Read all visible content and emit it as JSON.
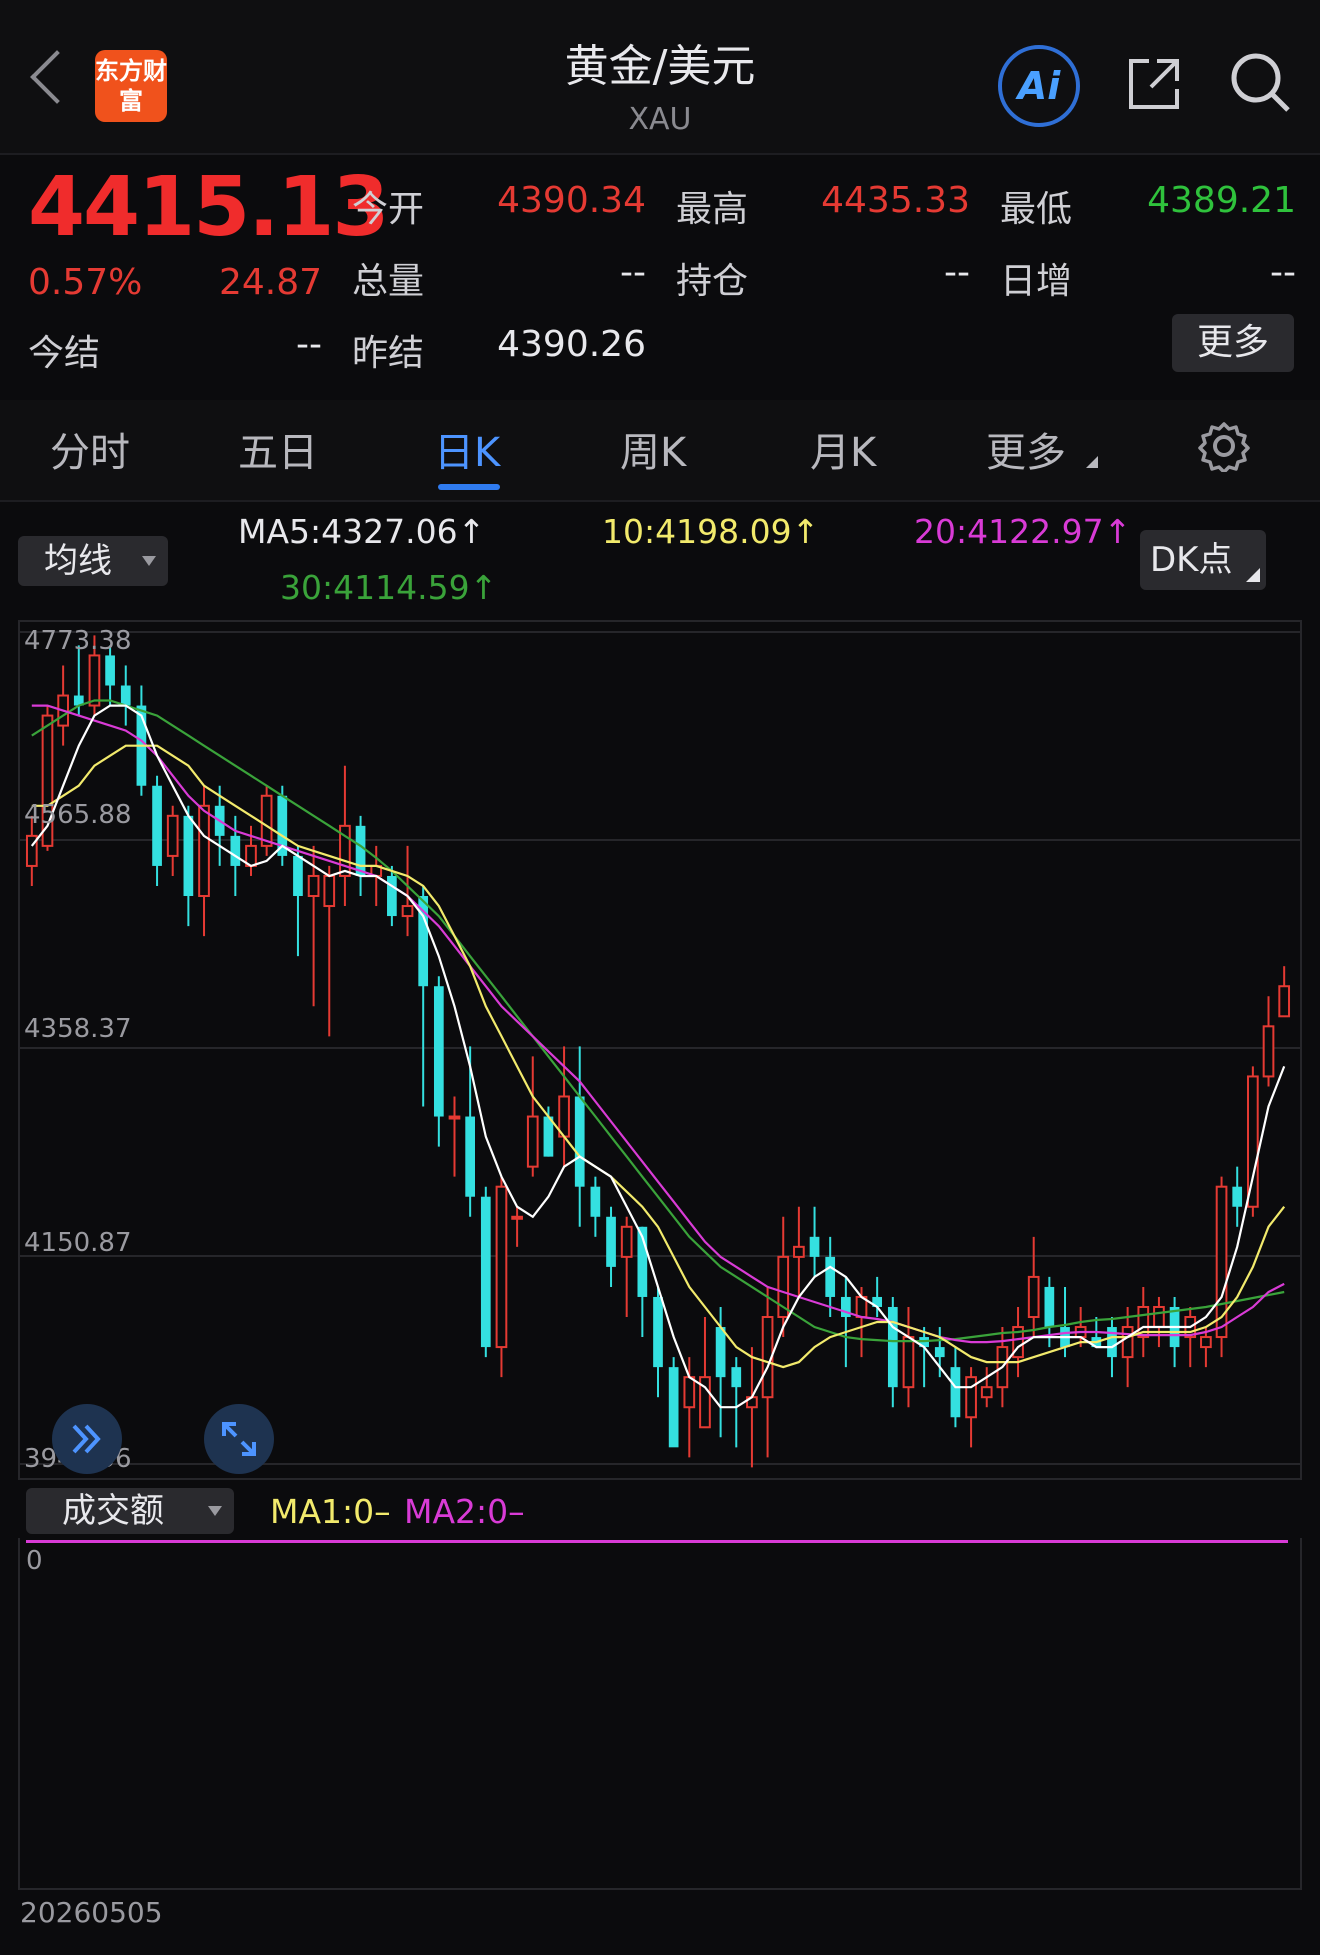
{
  "header": {
    "logo_text": "东方财富",
    "title": "黄金/美元",
    "subtitle": "XAU",
    "ai_label": "Ai"
  },
  "quote": {
    "price": "4415.13",
    "change_pct": "0.57%",
    "change": "24.87",
    "open_label": "今开",
    "open": "4390.34",
    "high_label": "最高",
    "high": "4435.33",
    "low_label": "最低",
    "low": "4389.21",
    "volume_label": "总量",
    "volume": "--",
    "oi_label": "持仓",
    "oi": "--",
    "daily_inc_label": "日增",
    "daily_inc": "--",
    "settle_label": "今结",
    "settle": "--",
    "prev_settle_label": "昨结",
    "prev_settle": "4390.26",
    "more_label": "更多"
  },
  "tabs": [
    {
      "label": "分时"
    },
    {
      "label": "五日"
    },
    {
      "label": "日K"
    },
    {
      "label": "周K"
    },
    {
      "label": "月K"
    },
    {
      "label": "更多"
    }
  ],
  "indicator": {
    "selector_label": "均线",
    "ma5": "MA5:4327.06",
    "ma10": "10:4198.09",
    "ma20": "20:4122.97",
    "ma30": "30:4114.59",
    "arrow": "↑",
    "dk_label": "DK点"
  },
  "colors": {
    "up": "#e53a33",
    "down": "#34e0e0",
    "ma5": "#ffffff",
    "ma10": "#f2ea6c",
    "ma20": "#d93bd6",
    "ma30": "#3aa33a"
  },
  "chart_data": {
    "type": "candlestick",
    "y_ticks": [
      "4773.38",
      "4565.88",
      "4358.37",
      "4150.87",
      "3943.36"
    ],
    "ylim": [
      3943.36,
      4773.38
    ],
    "candles": [
      [
        4540,
        4570,
        4520,
        4590,
        "up"
      ],
      [
        4560,
        4690,
        4555,
        4700,
        "up"
      ],
      [
        4680,
        4710,
        4660,
        4740,
        "up"
      ],
      [
        4710,
        4700,
        4690,
        4760,
        "down"
      ],
      [
        4700,
        4750,
        4690,
        4770,
        "up"
      ],
      [
        4750,
        4720,
        4700,
        4760,
        "down"
      ],
      [
        4720,
        4700,
        4680,
        4740,
        "down"
      ],
      [
        4700,
        4620,
        4610,
        4720,
        "down"
      ],
      [
        4620,
        4540,
        4520,
        4630,
        "down"
      ],
      [
        4550,
        4590,
        4530,
        4600,
        "up"
      ],
      [
        4590,
        4510,
        4480,
        4600,
        "down"
      ],
      [
        4510,
        4600,
        4470,
        4620,
        "up"
      ],
      [
        4600,
        4570,
        4540,
        4620,
        "down"
      ],
      [
        4570,
        4540,
        4510,
        4590,
        "down"
      ],
      [
        4540,
        4560,
        4530,
        4580,
        "up"
      ],
      [
        4560,
        4610,
        4550,
        4620,
        "up"
      ],
      [
        4610,
        4550,
        4540,
        4620,
        "down"
      ],
      [
        4550,
        4510,
        4450,
        4560,
        "down"
      ],
      [
        4510,
        4530,
        4400,
        4560,
        "up"
      ],
      [
        4500,
        4530,
        4370,
        4540,
        "up"
      ],
      [
        4530,
        4580,
        4500,
        4640,
        "up"
      ],
      [
        4580,
        4530,
        4510,
        4590,
        "down"
      ],
      [
        4540,
        4530,
        4500,
        4560,
        "up"
      ],
      [
        4530,
        4490,
        4480,
        4540,
        "down"
      ],
      [
        4490,
        4500,
        4470,
        4560,
        "up"
      ],
      [
        4510,
        4420,
        4300,
        4520,
        "down"
      ],
      [
        4420,
        4290,
        4260,
        4430,
        "down"
      ],
      [
        4290,
        4290,
        4230,
        4310,
        "up"
      ],
      [
        4290,
        4210,
        4190,
        4360,
        "down"
      ],
      [
        4210,
        4060,
        4050,
        4220,
        "down"
      ],
      [
        4060,
        4220,
        4030,
        4230,
        "up"
      ],
      [
        4190,
        4190,
        4160,
        4200,
        "up"
      ],
      [
        4240,
        4290,
        4230,
        4350,
        "up"
      ],
      [
        4290,
        4250,
        4250,
        4300,
        "down"
      ],
      [
        4270,
        4310,
        4240,
        4360,
        "up"
      ],
      [
        4310,
        4220,
        4180,
        4360,
        "down"
      ],
      [
        4220,
        4190,
        4170,
        4230,
        "down"
      ],
      [
        4190,
        4140,
        4120,
        4200,
        "down"
      ],
      [
        4150,
        4180,
        4090,
        4190,
        "up"
      ],
      [
        4180,
        4110,
        4070,
        4180,
        "down"
      ],
      [
        4110,
        4040,
        4010,
        4120,
        "down"
      ],
      [
        4040,
        3960,
        3970,
        4050,
        "down"
      ],
      [
        4000,
        4030,
        3950,
        4050,
        "up"
      ],
      [
        4030,
        3980,
        3980,
        4090,
        "up"
      ],
      [
        4080,
        4030,
        3970,
        4100,
        "down"
      ],
      [
        4040,
        4020,
        3960,
        4050,
        "down"
      ],
      [
        4000,
        4010,
        3940,
        4060,
        "up"
      ],
      [
        4010,
        4090,
        3950,
        4120,
        "up"
      ],
      [
        4090,
        4150,
        4070,
        4190,
        "up"
      ],
      [
        4150,
        4160,
        4110,
        4200,
        "up"
      ],
      [
        4170,
        4150,
        4130,
        4200,
        "down"
      ],
      [
        4150,
        4110,
        4090,
        4170,
        "down"
      ],
      [
        4110,
        4090,
        4040,
        4130,
        "down"
      ],
      [
        4090,
        4110,
        4050,
        4120,
        "up"
      ],
      [
        4110,
        4100,
        4090,
        4130,
        "down"
      ],
      [
        4100,
        4020,
        4000,
        4110,
        "down"
      ],
      [
        4020,
        4070,
        4000,
        4100,
        "up"
      ],
      [
        4070,
        4060,
        4020,
        4080,
        "down"
      ],
      [
        4060,
        4050,
        4030,
        4080,
        "down"
      ],
      [
        4040,
        3990,
        3980,
        4060,
        "down"
      ],
      [
        3990,
        4030,
        3960,
        4040,
        "up"
      ],
      [
        4010,
        4020,
        4000,
        4040,
        "up"
      ],
      [
        4020,
        4060,
        4000,
        4080,
        "up"
      ],
      [
        4050,
        4080,
        4030,
        4100,
        "up"
      ],
      [
        4090,
        4130,
        4070,
        4170,
        "up"
      ],
      [
        4120,
        4080,
        4060,
        4130,
        "down"
      ],
      [
        4080,
        4060,
        4050,
        4120,
        "down"
      ],
      [
        4070,
        4080,
        4060,
        4100,
        "up"
      ],
      [
        4070,
        4060,
        4060,
        4090,
        "down"
      ],
      [
        4080,
        4050,
        4030,
        4090,
        "down"
      ],
      [
        4050,
        4080,
        4020,
        4100,
        "up"
      ],
      [
        4070,
        4100,
        4050,
        4120,
        "up"
      ],
      [
        4080,
        4100,
        4060,
        4110,
        "up"
      ],
      [
        4100,
        4060,
        4040,
        4110,
        "down"
      ],
      [
        4070,
        4090,
        4040,
        4100,
        "up"
      ],
      [
        4060,
        4070,
        4040,
        4080,
        "up"
      ],
      [
        4070,
        4220,
        4050,
        4230,
        "up"
      ],
      [
        4220,
        4200,
        4180,
        4240,
        "down"
      ],
      [
        4200,
        4330,
        4190,
        4340,
        "up"
      ],
      [
        4330,
        4380,
        4320,
        4410,
        "up"
      ],
      [
        4390,
        4420,
        4390,
        4440,
        "up"
      ]
    ],
    "ma5": [
      4560,
      4580,
      4620,
      4660,
      4690,
      4700,
      4700,
      4690,
      4650,
      4620,
      4590,
      4570,
      4560,
      4550,
      4540,
      4545,
      4560,
      4550,
      4540,
      4530,
      4535,
      4530,
      4530,
      4520,
      4510,
      4490,
      4450,
      4400,
      4340,
      4270,
      4230,
      4200,
      4190,
      4210,
      4240,
      4250,
      4240,
      4230,
      4200,
      4170,
      4120,
      4070,
      4030,
      4020,
      4000,
      4000,
      4010,
      4040,
      4080,
      4110,
      4130,
      4140,
      4130,
      4110,
      4100,
      4080,
      4070,
      4060,
      4040,
      4020,
      4020,
      4030,
      4040,
      4060,
      4070,
      4070,
      4070,
      4070,
      4060,
      4060,
      4070,
      4080,
      4080,
      4080,
      4080,
      4090,
      4110,
      4160,
      4230,
      4300,
      4340
    ],
    "ma10": [
      4600,
      4600,
      4610,
      4620,
      4640,
      4650,
      4660,
      4660,
      4660,
      4650,
      4640,
      4620,
      4610,
      4600,
      4590,
      4580,
      4570,
      4560,
      4555,
      4550,
      4545,
      4540,
      4540,
      4535,
      4530,
      4520,
      4500,
      4470,
      4440,
      4400,
      4370,
      4340,
      4310,
      4290,
      4270,
      4250,
      4240,
      4230,
      4215,
      4200,
      4180,
      4150,
      4120,
      4100,
      4080,
      4060,
      4050,
      4045,
      4040,
      4045,
      4060,
      4070,
      4075,
      4080,
      4085,
      4085,
      4080,
      4075,
      4070,
      4060,
      4050,
      4045,
      4045,
      4045,
      4050,
      4055,
      4060,
      4065,
      4065,
      4070,
      4070,
      4075,
      4075,
      4075,
      4075,
      4080,
      4090,
      4110,
      4140,
      4180,
      4200
    ],
    "ma20": [
      4700,
      4700,
      4695,
      4690,
      4685,
      4680,
      4675,
      4665,
      4650,
      4630,
      4610,
      4595,
      4585,
      4575,
      4570,
      4565,
      4560,
      4555,
      4550,
      4545,
      4540,
      4535,
      4530,
      4520,
      4510,
      4495,
      4480,
      4460,
      4440,
      4420,
      4400,
      4385,
      4370,
      4355,
      4340,
      4325,
      4305,
      4285,
      4265,
      4245,
      4225,
      4205,
      4185,
      4165,
      4150,
      4140,
      4130,
      4120,
      4115,
      4110,
      4105,
      4100,
      4095,
      4090,
      4088,
      4085,
      4080,
      4075,
      4070,
      4067,
      4065,
      4065,
      4066,
      4068,
      4070,
      4072,
      4074,
      4075,
      4075,
      4074,
      4073,
      4072,
      4072,
      4072,
      4072,
      4075,
      4080,
      4090,
      4100,
      4115,
      4123
    ],
    "ma30": [
      4670,
      4680,
      4690,
      4700,
      4705,
      4705,
      4700,
      4695,
      4690,
      4680,
      4670,
      4660,
      4650,
      4640,
      4630,
      4620,
      4610,
      4600,
      4590,
      4580,
      4570,
      4560,
      4548,
      4535,
      4520,
      4505,
      4490,
      4470,
      4450,
      4430,
      4410,
      4390,
      4370,
      4350,
      4330,
      4310,
      4290,
      4270,
      4250,
      4230,
      4210,
      4190,
      4170,
      4155,
      4140,
      4130,
      4120,
      4110,
      4100,
      4090,
      4080,
      4075,
      4070,
      4068,
      4067,
      4066,
      4066,
      4066,
      4067,
      4068,
      4070,
      4072,
      4074,
      4075,
      4077,
      4080,
      4082,
      4085,
      4087,
      4088,
      4090,
      4092,
      4094,
      4096,
      4098,
      4100,
      4103,
      4106,
      4109,
      4112,
      4115
    ]
  },
  "volume": {
    "selector_label": "成交额",
    "ma1": "MA1:0–",
    "ma2": "MA2:0–",
    "zero_label": "0",
    "date_label": "20260505"
  }
}
